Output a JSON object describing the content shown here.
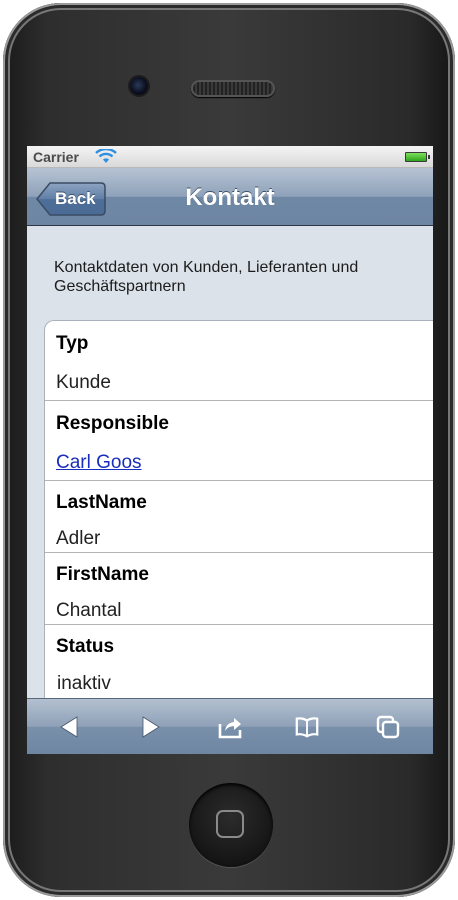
{
  "status_bar": {
    "carrier": "Carrier",
    "wifi_icon": "wifi-icon",
    "battery_icon": "battery-full-icon",
    "battery_level": 1.0,
    "battery_color": "#4cc72d"
  },
  "nav": {
    "back_label": "Back",
    "title": "Kontakt"
  },
  "intro": "Kontaktdaten von Kunden, Lieferanten und Geschäftspartnern",
  "fields": [
    {
      "label": "Typ",
      "value": "Kunde"
    },
    {
      "label": "Responsible",
      "value": "Carl Goos",
      "link_color": "#1a2ebd"
    },
    {
      "label": "LastName",
      "value": "Adler"
    },
    {
      "label": "FirstName",
      "value": "Chantal"
    },
    {
      "label": "Status",
      "value": "inaktiv"
    }
  ],
  "toolbar": {
    "icons": [
      "back-arrow-icon",
      "forward-arrow-icon",
      "share-icon",
      "bookmarks-icon",
      "tabs-icon"
    ]
  },
  "colors": {
    "nav_bar": "#7f95b0",
    "background": "#dbe2ea",
    "link": "#1a2ebd"
  }
}
